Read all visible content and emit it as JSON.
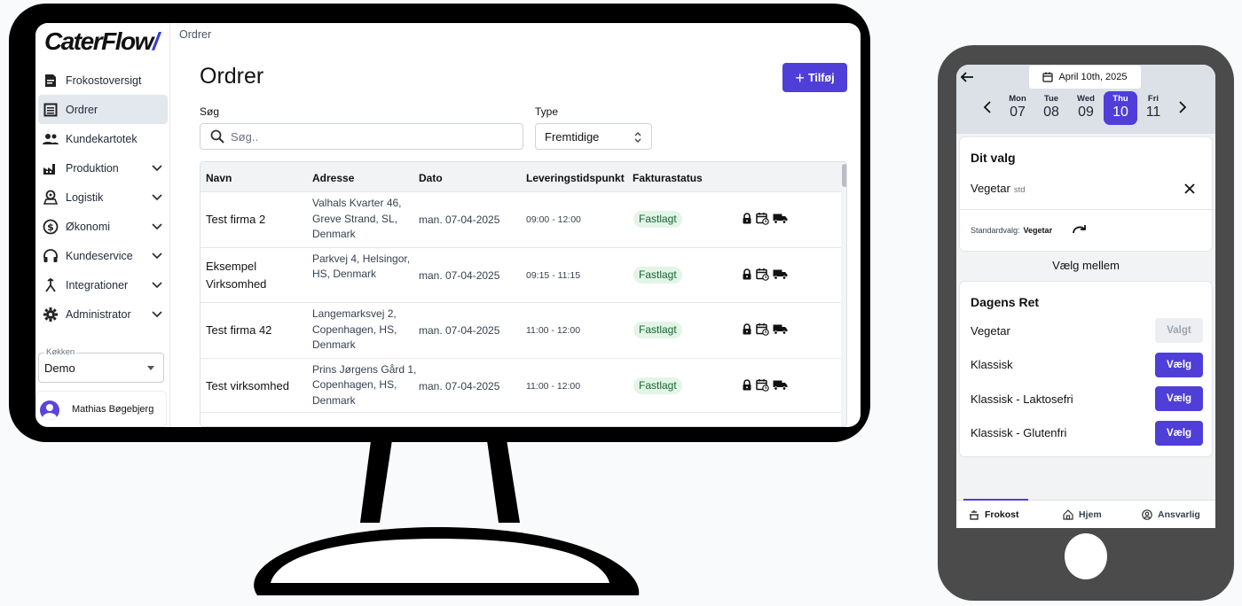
{
  "app": {
    "logo": "CaterFlow",
    "breadcrumb": "Ordrer",
    "page_title": "Ordrer",
    "add_button": "Tilføj",
    "accent_color": "#4f3fd8"
  },
  "sidebar": {
    "items": [
      {
        "label": "Frokostoversigt",
        "icon": "lunch-report-icon"
      },
      {
        "label": "Ordrer",
        "icon": "list-icon"
      },
      {
        "label": "Kundekartotek",
        "icon": "people-icon"
      },
      {
        "label": "Produktion",
        "icon": "factory-icon"
      },
      {
        "label": "Logistik",
        "icon": "location-icon"
      },
      {
        "label": "Økonomi",
        "icon": "dollar-icon"
      },
      {
        "label": "Kundeservice",
        "icon": "headset-icon"
      },
      {
        "label": "Integrationer",
        "icon": "merge-icon"
      },
      {
        "label": "Administrator",
        "icon": "gear-icon"
      }
    ],
    "kitchen_label": "Køkken",
    "kitchen_value": "Demo",
    "user_name": "Mathias Bøgebjerg"
  },
  "filters": {
    "search_label": "Søg",
    "search_placeholder": "Søg..",
    "type_label": "Type",
    "type_value": "Fremtidige"
  },
  "table": {
    "headers": [
      "Navn",
      "Adresse",
      "Dato",
      "Leveringstidspunkt",
      "Fakturastatus"
    ],
    "rows": [
      {
        "name": "Test firma 2",
        "address": "Valhals Kvarter 46, Greve Strand, SL, Denmark",
        "date": "man. 07-04-2025",
        "time": "09:00 - 12:00",
        "status": "Fastlagt"
      },
      {
        "name": "Eksempel Virksomhed",
        "address": "Parkvej 4, Helsingor, HS, Denmark",
        "date": "man. 07-04-2025",
        "time": "09:15 - 11:15",
        "status": "Fastlagt"
      },
      {
        "name": "Test firma 42",
        "address": "Langemarksvej 2, Copenhagen, HS, Denmark",
        "date": "man. 07-04-2025",
        "time": "11:00 - 12:00",
        "status": "Fastlagt"
      },
      {
        "name": "Test virksomhed",
        "address": "Prins Jørgens Gård 1, Copenhagen, HS, Denmark",
        "date": "man. 07-04-2025",
        "time": "11:00 - 12:00",
        "status": "Fastlagt"
      }
    ]
  },
  "phone": {
    "date": "April 10th, 2025",
    "days": [
      {
        "name": "Mon",
        "num": "07"
      },
      {
        "name": "Tue",
        "num": "08"
      },
      {
        "name": "Wed",
        "num": "09"
      },
      {
        "name": "Thu",
        "num": "10"
      },
      {
        "name": "Fri",
        "num": "11"
      }
    ],
    "your_choice_title": "Dit valg",
    "your_choice_value": "Vegetar",
    "your_choice_tag": "std",
    "default_label": "Standardvalg:",
    "default_value": "Vegetar",
    "choose_between": "Vælg mellem",
    "dish_title": "Dagens Ret",
    "dishes": [
      {
        "name": "Vegetar",
        "button": "Valgt"
      },
      {
        "name": "Klassisk",
        "button": "Vælg"
      },
      {
        "name": "Klassisk - Laktosefri",
        "button": "Vælg"
      },
      {
        "name": "Klassisk - Glutenfri",
        "button": "Vælg"
      }
    ],
    "tabs": [
      {
        "label": "Frokost",
        "icon": "lunch-icon"
      },
      {
        "label": "Hjem",
        "icon": "home-icon"
      },
      {
        "label": "Ansvarlig",
        "icon": "user-circle-icon"
      }
    ]
  }
}
